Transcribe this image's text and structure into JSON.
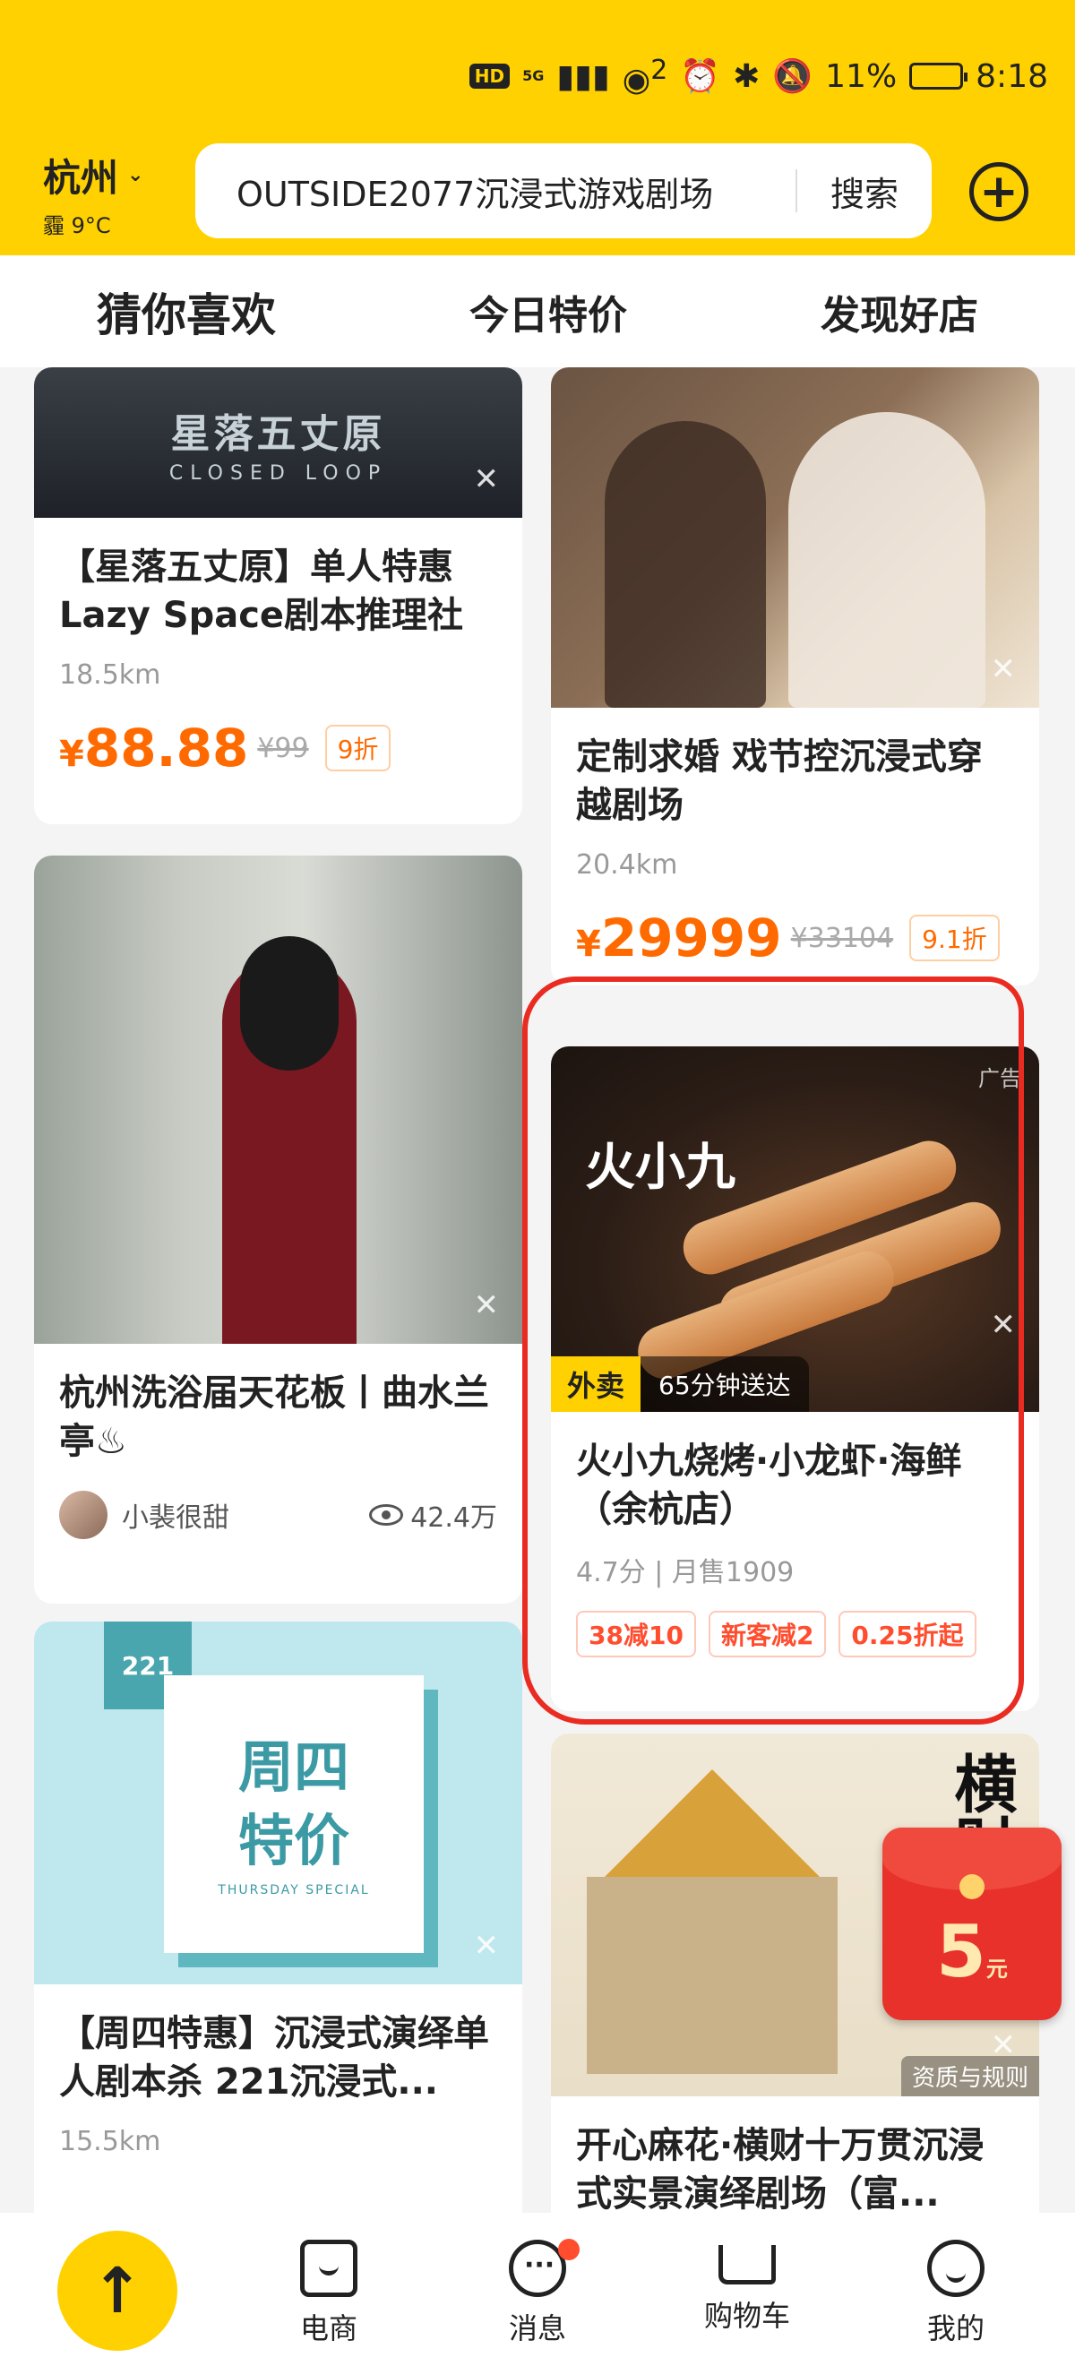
{
  "status_bar": {
    "network": "HD",
    "signal": "5G",
    "hotspot": "2",
    "battery": "11%",
    "time": "8:18"
  },
  "header": {
    "city": "杭州",
    "weather": "霾 9°C",
    "search_text": "OUTSIDE2077沉浸式游戏剧场",
    "search_button": "搜索"
  },
  "tabs": [
    {
      "label": "猜你喜欢",
      "active": true
    },
    {
      "label": "今日特价",
      "active": false
    },
    {
      "label": "发现好店",
      "active": false
    }
  ],
  "cards": {
    "game": {
      "image_title": "星落五丈原",
      "image_subtitle": "CLOSED LOOP",
      "title": "【星落五丈原】单人特惠Lazy Space剧本推理社",
      "distance": "18.5km",
      "price_symbol": "¥",
      "price": "88.88",
      "original": "¥99",
      "discount": "9折"
    },
    "wedding": {
      "title": "定制求婚 戏节控沉浸式穿越剧场",
      "distance": "20.4km",
      "price_symbol": "¥",
      "price": "29999",
      "original": "¥33104",
      "discount": "9.1折"
    },
    "bath": {
      "title": "杭州洗浴届天花板丨曲水兰亭♨",
      "author": "小裴很甜",
      "views": "42.4万"
    },
    "food": {
      "ad_label": "广告",
      "logo": "火小九",
      "delivery_tag": "外卖",
      "delivery_time": "65分钟送达",
      "title": "火小九烧烤·小龙虾·海鲜（余杭店）",
      "rating": "4.7分 | 月售1909",
      "promos": [
        "38减10",
        "新客减2",
        "0.25折起"
      ]
    },
    "thursday": {
      "logo": "221",
      "big1": "周四",
      "big2": "特价",
      "small": "THURSDAY SPECIAL",
      "title": "【周四特惠】沉浸式演绎单人剧本杀 221沉浸式...",
      "distance": "15.5km"
    },
    "palace": {
      "overlay": "横财",
      "qualification": "资质与规则",
      "title": "开心麻花·横财十万贯沉浸式实景演绎剧场（富..."
    }
  },
  "red_packet": {
    "amount": "5",
    "unit": "元"
  },
  "bottom_nav": [
    {
      "label": "电商",
      "icon": "shop-icon"
    },
    {
      "label": "消息",
      "icon": "message-icon"
    },
    {
      "label": "购物车",
      "icon": "cart-icon"
    },
    {
      "label": "我的",
      "icon": "profile-icon"
    }
  ],
  "colors": {
    "brand": "#ffd100",
    "price": "#ff6a00",
    "annotation": "#ea2b21"
  }
}
